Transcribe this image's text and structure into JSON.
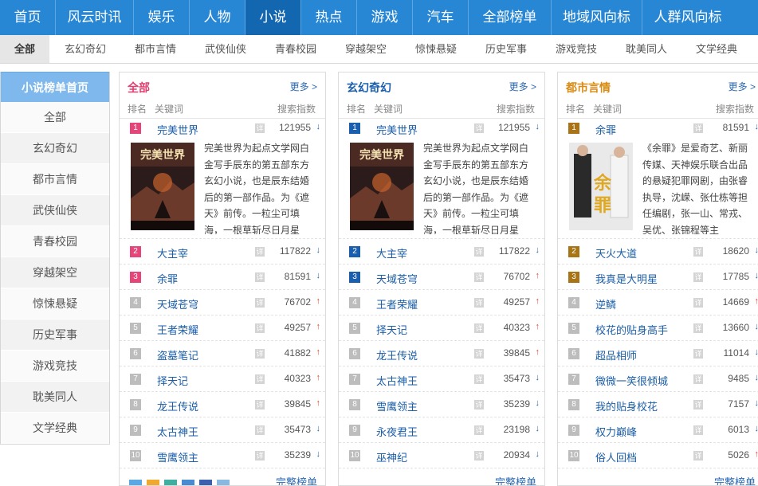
{
  "topnav": [
    "首页",
    "风云时讯",
    "娱乐",
    "人物",
    "小说",
    "热点",
    "游戏",
    "汽车",
    "全部榜单",
    "地域风向标",
    "人群风向标"
  ],
  "subnav": [
    "全部",
    "玄幻奇幻",
    "都市言情",
    "武侠仙侠",
    "青春校园",
    "穿越架空",
    "惊悚悬疑",
    "历史军事",
    "游戏竞技",
    "耽美同人",
    "文学经典"
  ],
  "sidebar": {
    "title": "小说榜单首页",
    "items": [
      "全部",
      "玄幻奇幻",
      "都市言情",
      "武侠仙侠",
      "青春校园",
      "穿越架空",
      "惊悚悬疑",
      "历史军事",
      "游戏竞技",
      "耽美同人",
      "文学经典"
    ]
  },
  "labels": {
    "more": "更多 >",
    "rank": "排名",
    "keyword": "关键词",
    "index": "搜索指数",
    "full_list": "完整榜单",
    "detail": "详"
  },
  "colors": {
    "nav_blue": "#2887d4",
    "nav_active": "#1366b0",
    "title_pink": "#e13d6f",
    "title_blue": "#1a5fae",
    "title_gold": "#d98c14"
  },
  "panels": [
    {
      "title": "全部",
      "description": "完美世界为起点文学网白金写手辰东的第五部东方玄幻小说，也是辰东结婚后的第一部作品。为《遮天》前传。一粒尘可填海，一根草斩尽日月星",
      "rows": [
        {
          "rank": "1",
          "keyword": "完美世界",
          "value": "121955",
          "trend": "down"
        },
        {
          "rank": "2",
          "keyword": "大主宰",
          "value": "117822",
          "trend": "down"
        },
        {
          "rank": "3",
          "keyword": "余罪",
          "value": "81591",
          "trend": "down"
        },
        {
          "rank": "4",
          "keyword": "天域苍穹",
          "value": "76702",
          "trend": "up"
        },
        {
          "rank": "5",
          "keyword": "王者荣耀",
          "value": "49257",
          "trend": "up"
        },
        {
          "rank": "6",
          "keyword": "盗墓笔记",
          "value": "41882",
          "trend": "up"
        },
        {
          "rank": "7",
          "keyword": "择天记",
          "value": "40323",
          "trend": "up"
        },
        {
          "rank": "8",
          "keyword": "龙王传说",
          "value": "39845",
          "trend": "up"
        },
        {
          "rank": "9",
          "keyword": "太古神王",
          "value": "35473",
          "trend": "down"
        },
        {
          "rank": "10",
          "keyword": "雪鹰领主",
          "value": "35239",
          "trend": "down"
        }
      ]
    },
    {
      "title": "玄幻奇幻",
      "description": "完美世界为起点文学网白金写手辰东的第五部东方玄幻小说，也是辰东结婚后的第一部作品。为《遮天》前传。一粒尘可填海，一根草斩尽日月星",
      "rows": [
        {
          "rank": "1",
          "keyword": "完美世界",
          "value": "121955",
          "trend": "down"
        },
        {
          "rank": "2",
          "keyword": "大主宰",
          "value": "117822",
          "trend": "down"
        },
        {
          "rank": "3",
          "keyword": "天域苍穹",
          "value": "76702",
          "trend": "up"
        },
        {
          "rank": "4",
          "keyword": "王者荣耀",
          "value": "49257",
          "trend": "up"
        },
        {
          "rank": "5",
          "keyword": "择天记",
          "value": "40323",
          "trend": "up"
        },
        {
          "rank": "6",
          "keyword": "龙王传说",
          "value": "39845",
          "trend": "up"
        },
        {
          "rank": "7",
          "keyword": "太古神王",
          "value": "35473",
          "trend": "down"
        },
        {
          "rank": "8",
          "keyword": "雪鹰领主",
          "value": "35239",
          "trend": "down"
        },
        {
          "rank": "9",
          "keyword": "永夜君王",
          "value": "23198",
          "trend": "down"
        },
        {
          "rank": "10",
          "keyword": "巫神纪",
          "value": "20934",
          "trend": "down"
        }
      ]
    },
    {
      "title": "都市言情",
      "description": "《余罪》是爱奇艺、新丽传媒、天神娱乐联合出品的悬疑犯罪网剧，由张睿执导，沈嵘、张仕栋等担任编剧，张一山、常戎、吴优、张锦程等主",
      "rows": [
        {
          "rank": "1",
          "keyword": "余罪",
          "value": "81591",
          "trend": "down"
        },
        {
          "rank": "2",
          "keyword": "天火大道",
          "value": "18620",
          "trend": "down"
        },
        {
          "rank": "3",
          "keyword": "我真是大明星",
          "value": "17785",
          "trend": "down"
        },
        {
          "rank": "4",
          "keyword": "逆鳞",
          "value": "14669",
          "trend": "up"
        },
        {
          "rank": "5",
          "keyword": "校花的贴身高手",
          "value": "13660",
          "trend": "down"
        },
        {
          "rank": "6",
          "keyword": "超品相师",
          "value": "11014",
          "trend": "down"
        },
        {
          "rank": "7",
          "keyword": "微微一笑很倾城",
          "value": "9485",
          "trend": "down"
        },
        {
          "rank": "8",
          "keyword": "我的贴身校花",
          "value": "7157",
          "trend": "down"
        },
        {
          "rank": "9",
          "keyword": "权力巅峰",
          "value": "6013",
          "trend": "down"
        },
        {
          "rank": "10",
          "keyword": "俗人回档",
          "value": "5026",
          "trend": "up"
        }
      ]
    }
  ]
}
